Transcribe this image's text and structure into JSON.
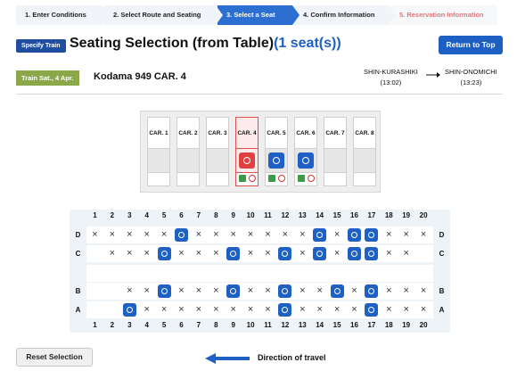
{
  "steps": [
    {
      "label": "1.  Enter Conditions",
      "state": "done"
    },
    {
      "label": "2.  Select Route and Seating",
      "state": "done"
    },
    {
      "label": "3.  Select a Seat",
      "state": "active"
    },
    {
      "label": "4.  Confirm Information",
      "state": "done"
    },
    {
      "label": "5.  Reservation Information",
      "state": "future"
    }
  ],
  "header": {
    "badge": "Specify Train",
    "title": "Seating Selection (from Table)",
    "seats": "(1 seat(s))",
    "return_button": "Return to Top"
  },
  "train": {
    "badge": "Train  Sat., 4 Apr.",
    "name": "Kodama 949  CAR. 4",
    "from_station": "SHIN-KURASHIKI",
    "from_time": "(13:02)",
    "to_station": "SHIN-ONOMICHI",
    "to_time": "(13:23)"
  },
  "cars": [
    {
      "label": "CAR. 1",
      "available": false,
      "selected": false
    },
    {
      "label": "CAR. 2",
      "available": false,
      "selected": false
    },
    {
      "label": "CAR. 3",
      "available": false,
      "selected": false
    },
    {
      "label": "CAR. 4",
      "available": true,
      "selected": true
    },
    {
      "label": "CAR. 5",
      "available": true,
      "selected": false
    },
    {
      "label": "CAR. 6",
      "available": true,
      "selected": false
    },
    {
      "label": "CAR. 7",
      "available": false,
      "selected": false
    },
    {
      "label": "CAR. 8",
      "available": false,
      "selected": false
    }
  ],
  "seatmap": {
    "columns": [
      "1",
      "2",
      "3",
      "4",
      "5",
      "6",
      "7",
      "8",
      "9",
      "10",
      "11",
      "12",
      "13",
      "14",
      "15",
      "16",
      "17",
      "18",
      "19",
      "20"
    ],
    "rows": [
      {
        "label": "D",
        "seats": [
          "x",
          "x",
          "x",
          "x",
          "x",
          "o",
          "x",
          "x",
          "x",
          "x",
          "x",
          "x",
          "x",
          "o",
          "x",
          "o",
          "o",
          "x",
          "x",
          "x"
        ]
      },
      {
        "label": "C",
        "seats": [
          "",
          "x",
          "x",
          "x",
          "o",
          "x",
          "x",
          "x",
          "o",
          "x",
          "x",
          "o",
          "x",
          "o",
          "x",
          "o",
          "o",
          "x",
          "x",
          ""
        ]
      },
      {
        "label": "",
        "seats": []
      },
      {
        "label": "B",
        "seats": [
          "",
          "",
          "x",
          "x",
          "o",
          "x",
          "x",
          "x",
          "o",
          "x",
          "x",
          "o",
          "x",
          "x",
          "o",
          "x",
          "o",
          "x",
          "x",
          "x"
        ]
      },
      {
        "label": "A",
        "seats": [
          "",
          "",
          "o",
          "x",
          "x",
          "x",
          "x",
          "x",
          "x",
          "x",
          "x",
          "o",
          "x",
          "x",
          "x",
          "x",
          "o",
          "x",
          "x",
          "x"
        ]
      }
    ]
  },
  "footer": {
    "reset_button": "Reset Selection",
    "direction_label": "Direction of travel"
  },
  "colors": {
    "accent": "#1f60c4",
    "selected_car": "#e04040",
    "train_badge": "#8aa84a"
  }
}
